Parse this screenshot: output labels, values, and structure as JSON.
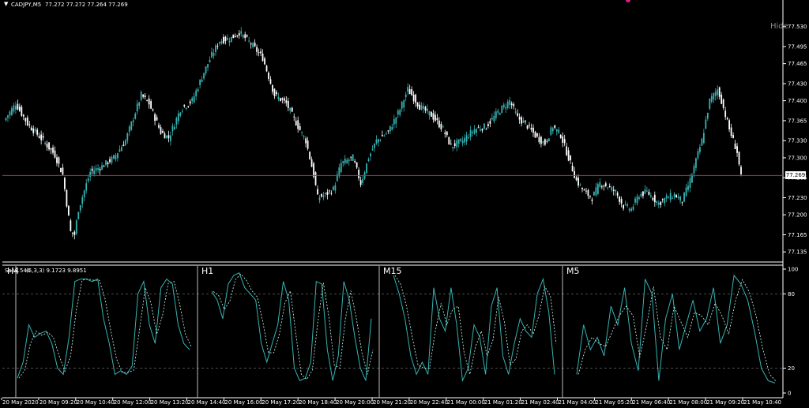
{
  "header": {
    "symbol_label": "CADJPY,M5",
    "ohlc_label": "77.272 77.272 77.264 77.269"
  },
  "hide_label": "Hide",
  "price_line": {
    "value": 77.269,
    "label": "77.269",
    "color": "#b03060"
  },
  "colors": {
    "bull": "#36b3b3",
    "bear": "#ffffff",
    "background": "#000000",
    "osc": "#36b3b3"
  },
  "chart_data": [
    {
      "type": "candlestick",
      "ylim": [
        77.12,
        77.56
      ],
      "yticks": [
        "77.530",
        "77.495",
        "77.465",
        "77.430",
        "77.400",
        "77.365",
        "77.330",
        "77.300",
        "77.265",
        "77.230",
        "77.200",
        "77.165",
        "77.135"
      ],
      "ytick_values": [
        77.53,
        77.495,
        77.465,
        77.43,
        77.4,
        77.365,
        77.33,
        77.3,
        77.265,
        77.23,
        77.2,
        77.165,
        77.135
      ],
      "close_path": [
        [
          0,
          77.365
        ],
        [
          6,
          77.395
        ],
        [
          12,
          77.36
        ],
        [
          20,
          77.33
        ],
        [
          26,
          77.305
        ],
        [
          30,
          77.27
        ],
        [
          34,
          77.17
        ],
        [
          36,
          77.165
        ],
        [
          38,
          77.21
        ],
        [
          44,
          77.275
        ],
        [
          50,
          77.285
        ],
        [
          56,
          77.3
        ],
        [
          62,
          77.33
        ],
        [
          70,
          77.41
        ],
        [
          74,
          77.395
        ],
        [
          80,
          77.345
        ],
        [
          84,
          77.335
        ],
        [
          90,
          77.385
        ],
        [
          96,
          77.4
        ],
        [
          102,
          77.45
        ],
        [
          106,
          77.48
        ],
        [
          110,
          77.505
        ],
        [
          116,
          77.51
        ],
        [
          120,
          77.52
        ],
        [
          126,
          77.5
        ],
        [
          132,
          77.475
        ],
        [
          138,
          77.41
        ],
        [
          144,
          77.395
        ],
        [
          150,
          77.355
        ],
        [
          154,
          77.33
        ],
        [
          158,
          77.27
        ],
        [
          160,
          77.23
        ],
        [
          164,
          77.235
        ],
        [
          168,
          77.245
        ],
        [
          172,
          77.29
        ],
        [
          178,
          77.3
        ],
        [
          182,
          77.255
        ],
        [
          186,
          77.3
        ],
        [
          190,
          77.33
        ],
        [
          196,
          77.345
        ],
        [
          202,
          77.385
        ],
        [
          206,
          77.42
        ],
        [
          212,
          77.39
        ],
        [
          218,
          77.375
        ],
        [
          224,
          77.35
        ],
        [
          228,
          77.32
        ],
        [
          234,
          77.33
        ],
        [
          240,
          77.35
        ],
        [
          246,
          77.355
        ],
        [
          252,
          77.38
        ],
        [
          258,
          77.4
        ],
        [
          262,
          77.37
        ],
        [
          266,
          77.36
        ],
        [
          272,
          77.335
        ],
        [
          276,
          77.325
        ],
        [
          280,
          77.355
        ],
        [
          284,
          77.34
        ],
        [
          288,
          77.3
        ],
        [
          292,
          77.26
        ],
        [
          296,
          77.24
        ],
        [
          300,
          77.23
        ],
        [
          304,
          77.255
        ],
        [
          308,
          77.25
        ],
        [
          312,
          77.24
        ],
        [
          316,
          77.215
        ],
        [
          320,
          77.21
        ],
        [
          324,
          77.235
        ],
        [
          328,
          77.24
        ],
        [
          334,
          77.22
        ],
        [
          338,
          77.23
        ],
        [
          342,
          77.235
        ],
        [
          346,
          77.225
        ],
        [
          350,
          77.26
        ],
        [
          356,
          77.33
        ],
        [
          360,
          77.4
        ],
        [
          364,
          77.42
        ],
        [
          366,
          77.4
        ],
        [
          370,
          77.35
        ],
        [
          374,
          77.31
        ],
        [
          376,
          77.265
        ]
      ],
      "subwindow": {
        "indicator_label": "Salix 544",
        "params_label": "(5,3,3) 9.1723 9.8951",
        "ylim": [
          0,
          100
        ],
        "yticks": [
          "100",
          "80",
          "20",
          "0"
        ],
        "ytick_values": [
          100,
          80,
          20,
          0
        ],
        "levels": [
          80,
          20
        ],
        "panels": [
          {
            "label": "H4",
            "series": [
              12,
              25,
              55,
              45,
              48,
              50,
              40,
              20,
              15,
              45,
              90,
              92,
              92,
              90,
              92,
              60,
              40,
              15,
              18,
              15,
              22,
              80,
              90,
              55,
              40,
              85,
              92,
              88,
              55,
              40,
              35
            ]
          },
          {
            "label": "H1",
            "series": [
              82,
              75,
              60,
              88,
              95,
              97,
              85,
              80,
              75,
              40,
              25,
              40,
              55,
              90,
              75,
              20,
              10,
              12,
              25,
              90,
              88,
              35,
              10,
              30,
              90,
              75,
              45,
              20,
              10,
              60
            ]
          },
          {
            "label": "M15",
            "series": [
              95,
              80,
              60,
              30,
              15,
              25,
              15,
              85,
              60,
              50,
              85,
              55,
              10,
              20,
              55,
              45,
              15,
              70,
              85,
              30,
              15,
              40,
              60,
              50,
              45,
              80,
              92,
              65,
              15
            ]
          },
          {
            "label": "M5",
            "series": [
              15,
              55,
              35,
              45,
              30,
              70,
              55,
              85,
              40,
              18,
              92,
              80,
              10,
              60,
              80,
              35,
              55,
              75,
              50,
              60,
              85,
              40,
              55,
              95,
              88,
              75,
              50,
              20,
              10,
              8
            ]
          }
        ]
      },
      "xticks": [
        "20 May 2020",
        "20 May 09:20",
        "20 May 10:40",
        "20 May 12:00",
        "20 May 13:20",
        "20 May 14:40",
        "20 May 16:00",
        "20 May 17:20",
        "20 May 18:40",
        "20 May 20:00",
        "20 May 21:20",
        "20 May 22:40",
        "21 May 00:00",
        "21 May 01:20",
        "21 May 02:40",
        "21 May 04:00",
        "21 May 05:20",
        "21 May 06:40",
        "21 May 08:00",
        "21 May 09:20",
        "21 May 10:40"
      ]
    }
  ]
}
